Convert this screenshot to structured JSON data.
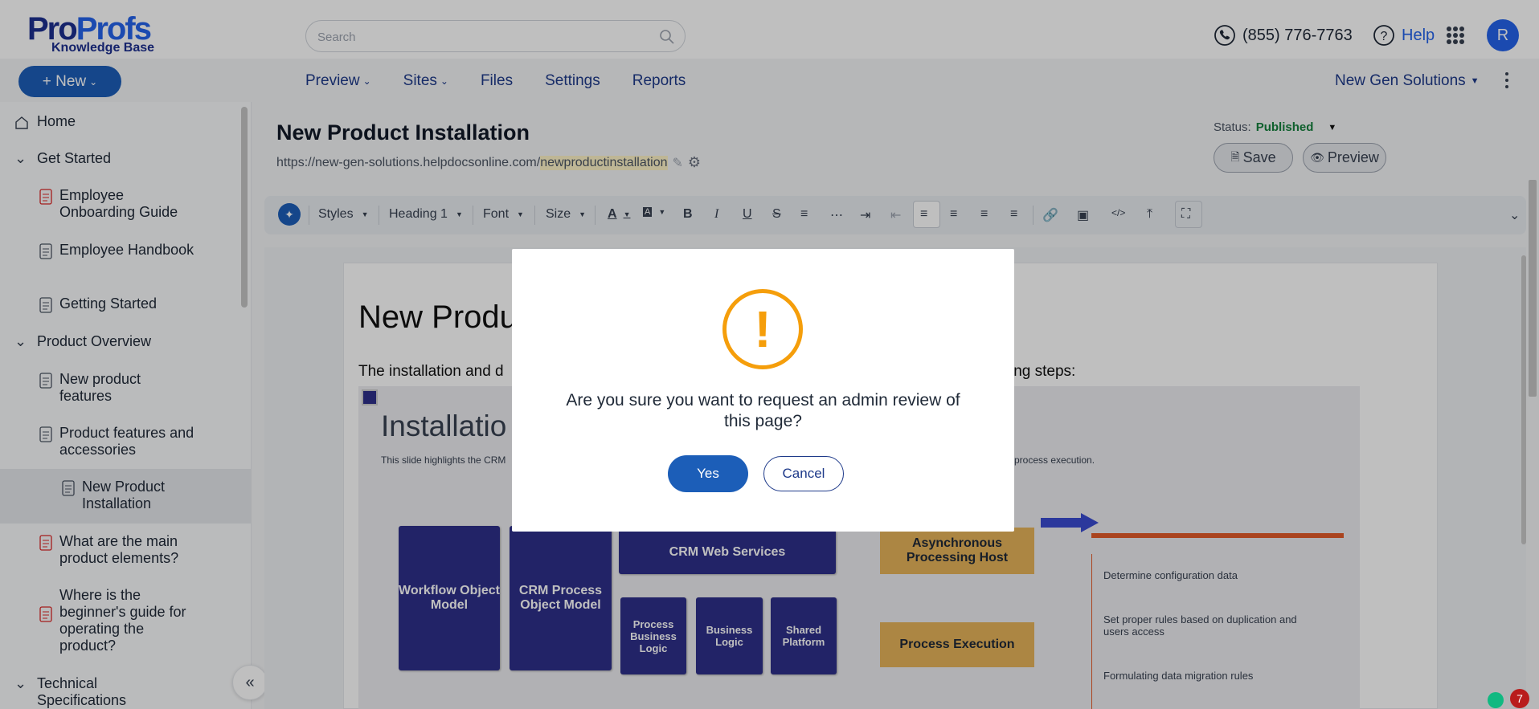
{
  "brand": {
    "logo_part1": "Pro",
    "logo_part2": "Profs",
    "logo_sub": "Knowledge Base"
  },
  "search": {
    "placeholder": "Search"
  },
  "header": {
    "phone": "(855) 776-7763",
    "help": "Help",
    "avatar_initial": "R"
  },
  "nav": {
    "new_label": "+ New",
    "items": [
      {
        "label": "Preview",
        "dropdown": true
      },
      {
        "label": "Sites",
        "dropdown": true
      },
      {
        "label": "Files",
        "dropdown": false
      },
      {
        "label": "Settings",
        "dropdown": false
      },
      {
        "label": "Reports",
        "dropdown": false
      }
    ],
    "org": "New Gen Solutions"
  },
  "sidebar": {
    "items": [
      {
        "label": "Home",
        "type": "home"
      },
      {
        "label": "Get Started",
        "type": "folder"
      },
      {
        "label": "Employee Onboarding Guide",
        "type": "page-red"
      },
      {
        "label": "Employee Handbook",
        "type": "page"
      },
      {
        "label": "Getting Started",
        "type": "page"
      },
      {
        "label": "Product Overview",
        "type": "folder"
      },
      {
        "label": "New product features",
        "type": "page"
      },
      {
        "label": "Product features and accessories",
        "type": "page"
      },
      {
        "label": "New Product Installation",
        "type": "page-active"
      },
      {
        "label": "What are the main product elements?",
        "type": "page-red"
      },
      {
        "label": "Where is the beginner's guide for operating the product?",
        "type": "page-red"
      },
      {
        "label": "Technical Specifications",
        "type": "folder"
      }
    ]
  },
  "page": {
    "title": "New Product Installation",
    "url_base": "https://new-gen-solutions.helpdocsonline.com/",
    "url_slug": "newproductinstallation",
    "status_label": "Status:",
    "status_value": "Published",
    "save_label": "Save",
    "preview_label": "Preview"
  },
  "toolbar": {
    "styles": "Styles",
    "heading": "Heading 1",
    "font": "Font",
    "size": "Size"
  },
  "document": {
    "heading_visible": "New Produ",
    "para_left": "The installation and d",
    "para_right": "ing steps:",
    "slide_title": "Installatio",
    "slide_sub_left": "This slide highlights the CRM",
    "slide_sub_right": "process execution.",
    "boxes": {
      "workflow": "Workflow Object Model",
      "crm_process": "CRM Process Object Model",
      "crm_web": "CRM Web Services",
      "process_business": "Process Business Logic",
      "business_logic": "Business Logic",
      "shared_platform": "Shared Platform",
      "async": "Asynchronous Processing Host",
      "process_exec": "Process Execution"
    },
    "steps": [
      "Determine configuration data",
      "Set proper rules based on duplication and users access",
      "Formulating data migration rules"
    ]
  },
  "modal": {
    "icon": "!",
    "message": "Are you sure you want to request an admin review of this page?",
    "yes_label": "Yes",
    "cancel_label": "Cancel"
  },
  "widget": {
    "badge": "7"
  },
  "colors": {
    "primary": "#1c5eb8",
    "warning": "#f59e0b",
    "published": "#15803d",
    "slide_box": "#2e2f8a",
    "slide_yellow": "#e6b35a"
  }
}
